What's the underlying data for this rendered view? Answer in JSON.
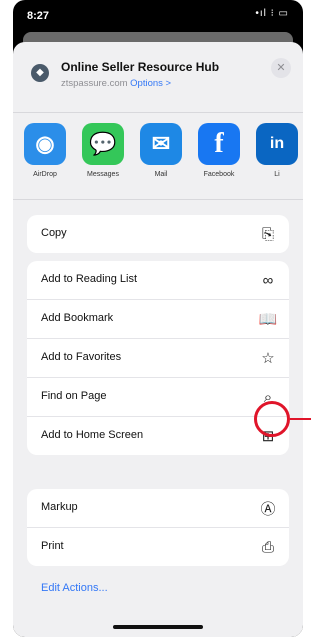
{
  "status_bar": {
    "time": "8:27",
    "indicators": "•ıl ⁝ ▭"
  },
  "header": {
    "title": "Online Seller Resource Hub",
    "subtitle": "ztspassure.com",
    "options_label": "Options >",
    "close_glyph": "✕"
  },
  "apps": [
    {
      "label": "AirDrop",
      "icon": "airdrop-icon",
      "color": "#2b8ee9",
      "glyph": "◉"
    },
    {
      "label": "Messages",
      "icon": "messages-icon",
      "color": "#34c759",
      "glyph": "💬"
    },
    {
      "label": "Mail",
      "icon": "mail-icon",
      "color": "#1e88e5",
      "glyph": "✉"
    },
    {
      "label": "Facebook",
      "icon": "facebook-icon",
      "color": "#1877f2",
      "glyph": "f"
    },
    {
      "label": "Li",
      "icon": "linkedin-icon",
      "color": "#0a66c2",
      "glyph": "in"
    }
  ],
  "actions": {
    "copy": {
      "label": "Copy",
      "glyph": "⎘"
    },
    "reading_list": {
      "label": "Add to Reading List",
      "glyph": "∞"
    },
    "bookmark": {
      "label": "Add Bookmark",
      "glyph": "📖"
    },
    "favorites": {
      "label": "Add to Favorites",
      "glyph": "☆"
    },
    "find": {
      "label": "Find on Page",
      "glyph": "⌕"
    },
    "home_screen": {
      "label": "Add to Home Screen",
      "glyph": "⊞"
    },
    "markup": {
      "label": "Markup",
      "glyph": "Ⓐ"
    },
    "print": {
      "label": "Print",
      "glyph": "⎙"
    }
  },
  "edit_actions_label": "Edit Actions...",
  "colors": {
    "accent": "#3478f6",
    "highlight": "#e0152a",
    "sheet_bg": "#f0f0f2"
  }
}
